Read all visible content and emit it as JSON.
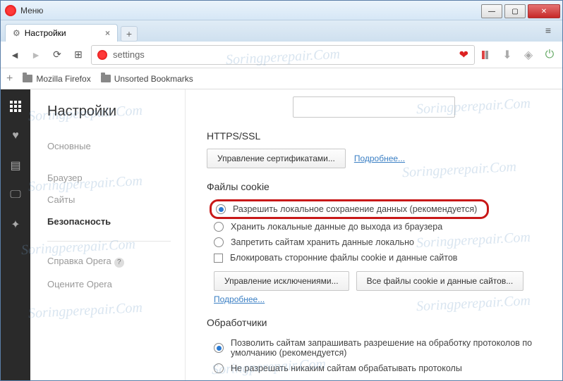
{
  "window": {
    "menu_label": "Меню"
  },
  "tab": {
    "title": "Настройки"
  },
  "url": {
    "value": "settings"
  },
  "bookmarks": {
    "folder1": "Mozilla Firefox",
    "folder2": "Unsorted Bookmarks"
  },
  "sidebar": {
    "title": "Настройки",
    "items": {
      "basic": "Основные",
      "browser": "Браузер",
      "sites": "Сайты",
      "security": "Безопасность",
      "help": "Справка Opera",
      "rate": "Оцените Opera"
    }
  },
  "https": {
    "title": "HTTPS/SSL",
    "cert_btn": "Управление сертификатами...",
    "more": "Подробнее..."
  },
  "cookies": {
    "title": "Файлы cookie",
    "opt1": "Разрешить локальное сохранение данных (рекомендуется)",
    "opt2": "Хранить локальные данные до выхода из браузера",
    "opt3": "Запретить сайтам хранить данные локально",
    "opt4": "Блокировать сторонние файлы cookie и данные сайтов",
    "exceptions_btn": "Управление исключениями...",
    "all_btn": "Все файлы cookie и данные сайтов...",
    "more": "Подробнее..."
  },
  "handlers": {
    "title": "Обработчики",
    "opt1": "Позволить сайтам запрашивать разрешение на обработку протоколов по умолчанию (рекомендуется)",
    "opt2": "Не разрешать никаким сайтам обрабатывать протоколы"
  },
  "watermark": "Soringperepair.Com"
}
